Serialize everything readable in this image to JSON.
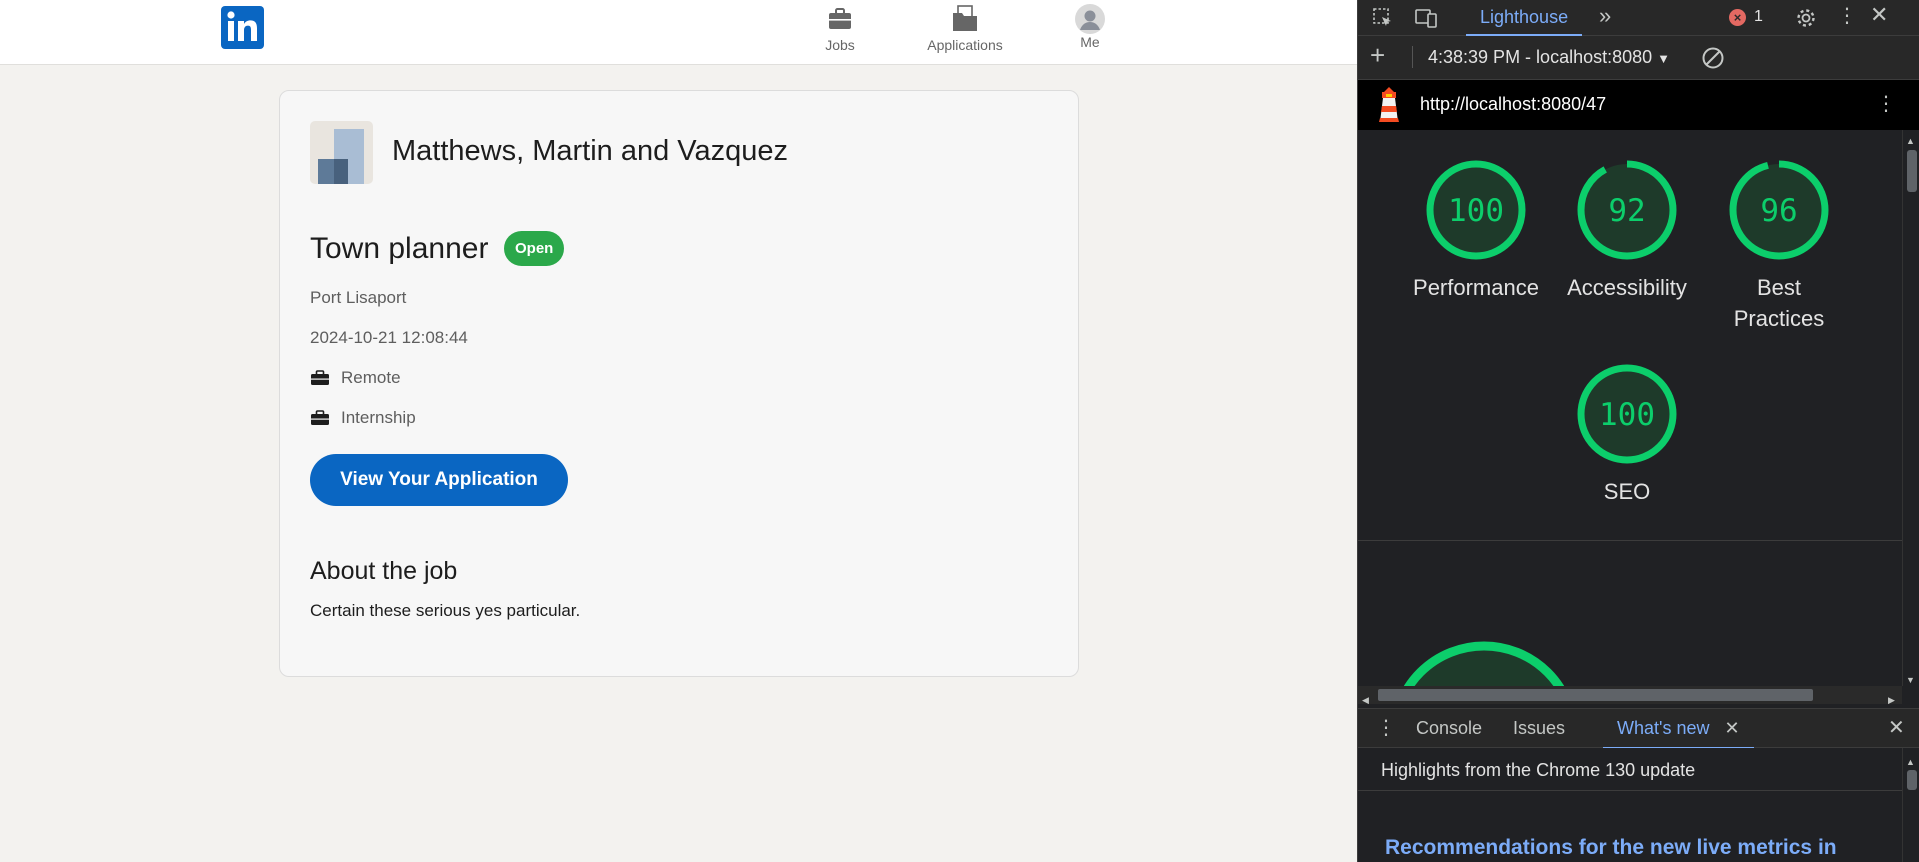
{
  "nav": {
    "jobs_label": "Jobs",
    "applications_label": "Applications",
    "me_label": "Me"
  },
  "job": {
    "company": "Matthews, Martin and Vazquez",
    "title": "Town planner",
    "status": "Open",
    "location": "Port Lisaport",
    "posted": "2024-10-21 12:08:44",
    "workplace": "Remote",
    "type": "Internship",
    "action_label": "View Your Application",
    "about_heading": "About the job",
    "description": "Certain these serious yes particular."
  },
  "devtools": {
    "active_panel": "Lighthouse",
    "error_count": "1",
    "report_label": "4:38:39 PM - localhost:8080",
    "url": "http://localhost:8080/47",
    "scores": [
      {
        "value": "100",
        "label": "Performance"
      },
      {
        "value": "92",
        "label": "Accessibility"
      },
      {
        "value": "96",
        "label_line1": "Best",
        "label_line2": "Practices"
      },
      {
        "value": "100",
        "label": "SEO"
      }
    ],
    "drawer": {
      "tab_console": "Console",
      "tab_issues": "Issues",
      "tab_whatsnew": "What's new",
      "heading": "Highlights from the Chrome 130 update",
      "link": "Recommendations for the new live metrics in"
    }
  },
  "colors": {
    "brand": "#0a66c2",
    "open_badge": "#2ba84a",
    "score_good": "#0cce6b",
    "devtools_accent": "#7cacf8"
  }
}
